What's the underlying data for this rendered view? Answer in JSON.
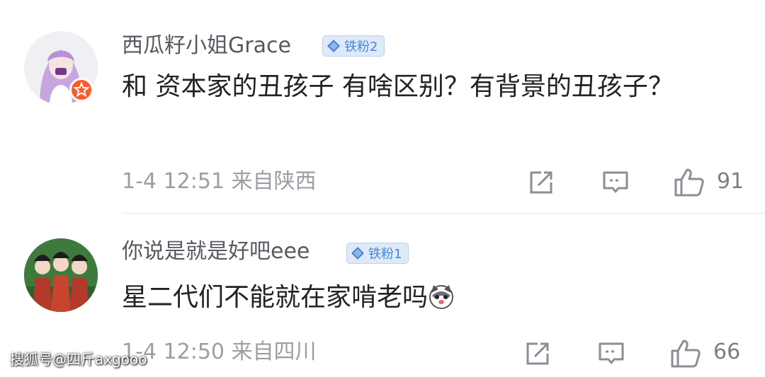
{
  "comments": [
    {
      "username": "西瓜籽小姐Grace",
      "badge": {
        "icon": "diamond-icon",
        "label": "铁粉2",
        "color": "#4a86d8"
      },
      "text": "和 资本家的丑孩子 有啥区别？有背景的丑孩子？",
      "meta": "1-4 12:51 来自陕西",
      "likes": "91"
    },
    {
      "username": "你说是就是好吧eee",
      "badge": {
        "icon": "diamond-icon",
        "label": "铁粉1",
        "color": "#4a86d8"
      },
      "text": "星二代们不能就在家啃老吗",
      "emoji": "husky-dog-emoji",
      "meta": "1-4 12:50 来自四川",
      "likes": "66"
    }
  ],
  "actions": {
    "share_icon": "share-icon",
    "reply_icon": "comment-icon",
    "like_icon": "thumbs-up-icon"
  },
  "watermark": "搜狐号@四斤axgooo",
  "colors": {
    "accent": "#4a86d8",
    "vip": "#ff5a2b",
    "meta": "#9a9fa6"
  }
}
